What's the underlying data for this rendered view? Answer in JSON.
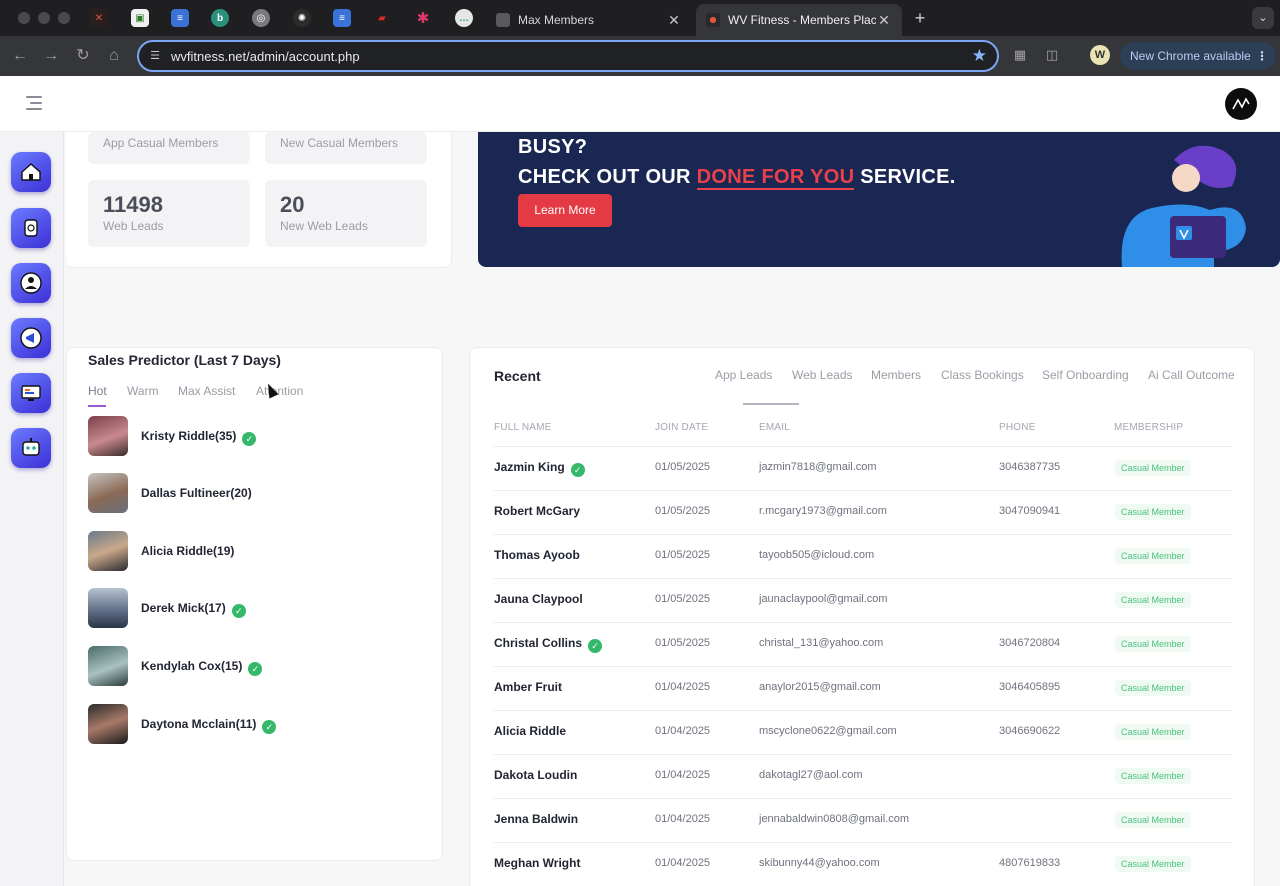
{
  "browser": {
    "tabs": [
      {
        "title": "Max Members"
      },
      {
        "title": "WV Fitness - Members Place"
      }
    ],
    "url": "wvfitness.net/admin/account.php",
    "update_label": "New Chrome available",
    "profile_letter": "W"
  },
  "stats": [
    {
      "value": "",
      "label": "App Casual Members"
    },
    {
      "value": "",
      "label": "New Casual Members"
    },
    {
      "value": "11498",
      "label": "Web Leads"
    },
    {
      "value": "20",
      "label": "New Web Leads"
    }
  ],
  "banner": {
    "line1": "BUSY?",
    "line2_pre": "CHECK OUT OUR ",
    "line2_accent": "DONE FOR YOU",
    "line2_post": " SERVICE.",
    "button": "Learn More",
    "colors": {
      "background": "#1a2752",
      "accent": "#e8414b"
    }
  },
  "sales_predictor": {
    "title": "Sales Predictor (Last 7 Days)",
    "tabs": [
      "Hot",
      "Warm",
      "Max Assist",
      "Attention"
    ],
    "people": [
      {
        "name": "Kristy Riddle(35)",
        "verified": true
      },
      {
        "name": "Dallas Fultineer(20)",
        "verified": false
      },
      {
        "name": "Alicia Riddle(19)",
        "verified": false
      },
      {
        "name": "Derek Mick(17)",
        "verified": true
      },
      {
        "name": "Kendylah Cox(15)",
        "verified": true
      },
      {
        "name": "Daytona Mcclain(11)",
        "verified": true
      }
    ]
  },
  "recent": {
    "title": "Recent",
    "tabs": [
      "App Leads",
      "Web Leads",
      "Members",
      "Class Bookings",
      "Self Onboarding",
      "Ai Call Outcome"
    ],
    "columns": [
      "FULL NAME",
      "JOIN DATE",
      "EMAIL",
      "PHONE",
      "MEMBERSHIP"
    ],
    "rows": [
      {
        "name": "Jazmin King",
        "verified": true,
        "date": "01/05/2025",
        "email": "jazmin7818@gmail.com",
        "phone": "3046387735",
        "membership": "Casual Member"
      },
      {
        "name": "Robert McGary",
        "verified": false,
        "date": "01/05/2025",
        "email": "r.mcgary1973@gmail.com",
        "phone": "3047090941",
        "membership": "Casual Member"
      },
      {
        "name": "Thomas Ayoob",
        "verified": false,
        "date": "01/05/2025",
        "email": "tayoob505@icloud.com",
        "phone": "",
        "membership": "Casual Member"
      },
      {
        "name": "Jauna Claypool",
        "verified": false,
        "date": "01/05/2025",
        "email": "jaunaclaypool@gmail.com",
        "phone": "",
        "membership": "Casual Member"
      },
      {
        "name": "Christal Collins",
        "verified": true,
        "date": "01/05/2025",
        "email": "christal_131@yahoo.com",
        "phone": "3046720804",
        "membership": "Casual Member"
      },
      {
        "name": "Amber Fruit",
        "verified": false,
        "date": "01/04/2025",
        "email": "anaylor2015@gmail.com",
        "phone": "3046405895",
        "membership": "Casual Member"
      },
      {
        "name": "Alicia Riddle",
        "verified": false,
        "date": "01/04/2025",
        "email": "mscyclone0622@gmail.com",
        "phone": "3046690622",
        "membership": "Casual Member"
      },
      {
        "name": "Dakota Loudin",
        "verified": false,
        "date": "01/04/2025",
        "email": "dakotagl27@aol.com",
        "phone": "",
        "membership": "Casual Member"
      },
      {
        "name": "Jenna Baldwin",
        "verified": false,
        "date": "01/04/2025",
        "email": "jennabaldwin0808@gmail.com",
        "phone": "",
        "membership": "Casual Member"
      },
      {
        "name": "Meghan Wright",
        "verified": false,
        "date": "01/04/2025",
        "email": "skibunny44@yahoo.com",
        "phone": "4807619833",
        "membership": "Casual Member"
      }
    ]
  },
  "icons": [
    "hamburger-icon",
    "home-icon",
    "watch-icon",
    "members-icon",
    "megaphone-icon",
    "monitor-icon",
    "robot-icon",
    "verified-icon",
    "star-icon"
  ]
}
